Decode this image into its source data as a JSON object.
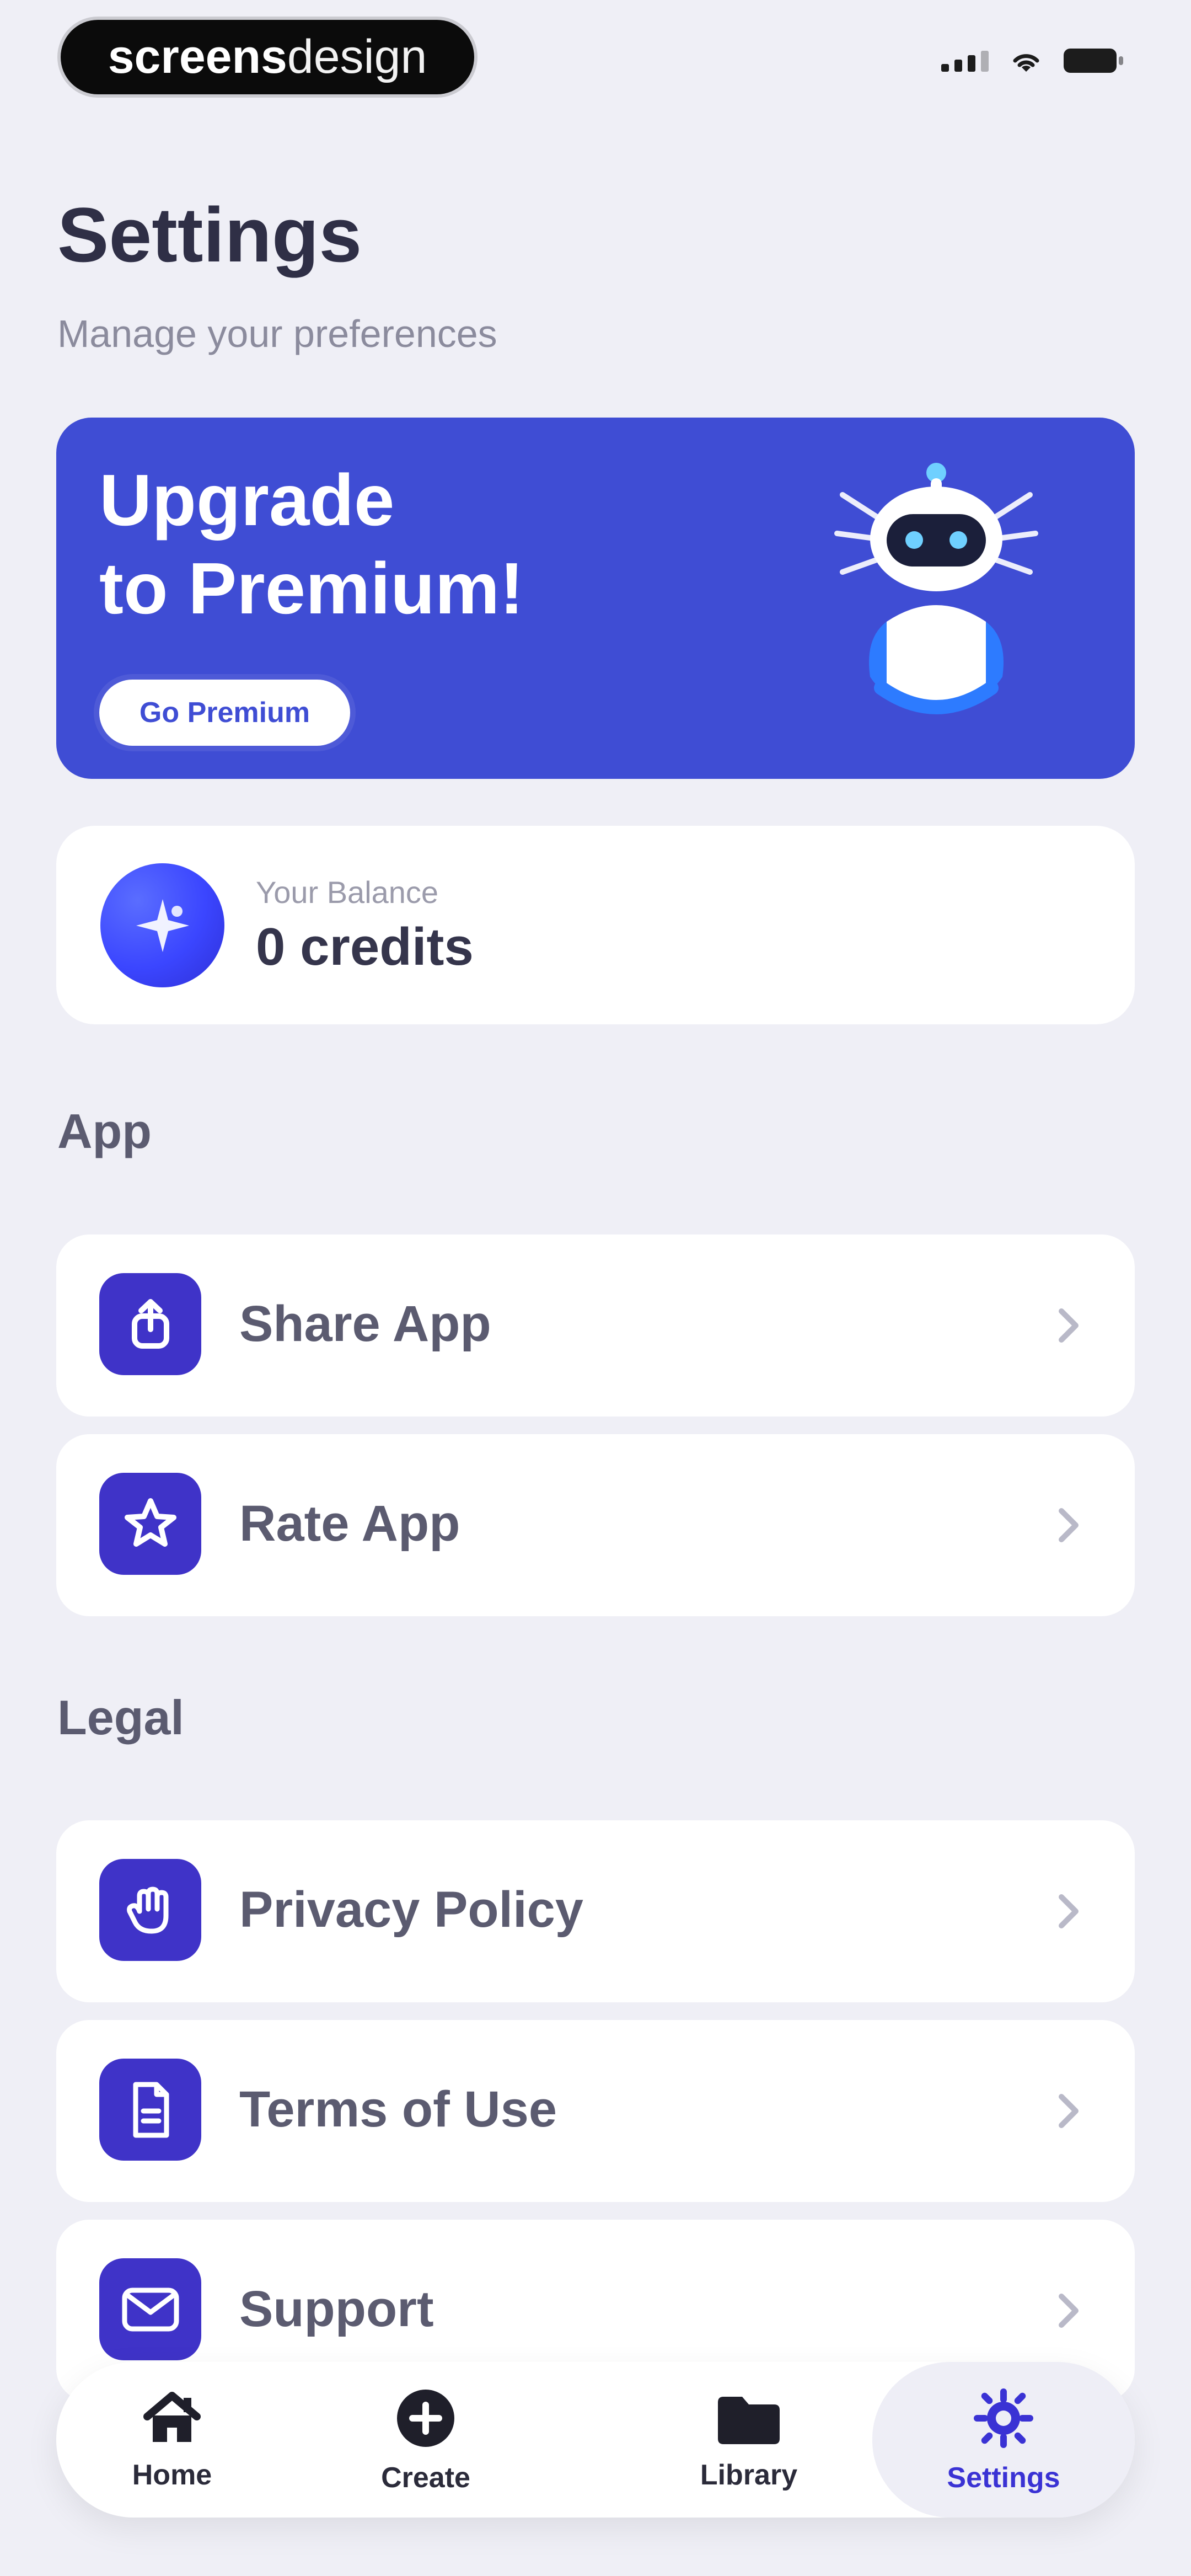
{
  "status_bar": {
    "brand_left": "screens",
    "brand_right": "design"
  },
  "header": {
    "title": "Settings",
    "subtitle": "Manage your preferences"
  },
  "premium_banner": {
    "title_line1": "Upgrade",
    "title_line2": "to Premium!",
    "button_label": "Go Premium"
  },
  "balance": {
    "label": "Your Balance",
    "value": "0 credits"
  },
  "sections": {
    "app": {
      "title": "App",
      "items": [
        {
          "label": "Share App",
          "icon": "share-icon"
        },
        {
          "label": "Rate App",
          "icon": "star-icon"
        }
      ]
    },
    "legal": {
      "title": "Legal",
      "items": [
        {
          "label": "Privacy Policy",
          "icon": "hand-icon"
        },
        {
          "label": "Terms of Use",
          "icon": "document-icon"
        },
        {
          "label": "Support",
          "icon": "mail-icon"
        }
      ]
    }
  },
  "tabbar": {
    "tabs": [
      {
        "label": "Home",
        "icon": "home-icon"
      },
      {
        "label": "Create",
        "icon": "plus-circle-icon"
      },
      {
        "label": "Library",
        "icon": "folder-icon"
      },
      {
        "label": "Settings",
        "icon": "gear-icon",
        "active": true
      }
    ]
  },
  "colors": {
    "background": "#efeff6",
    "accent": "#3f4dd4",
    "row_icon_bg": "#3f33c8",
    "active_tab": "#3a32d4"
  }
}
